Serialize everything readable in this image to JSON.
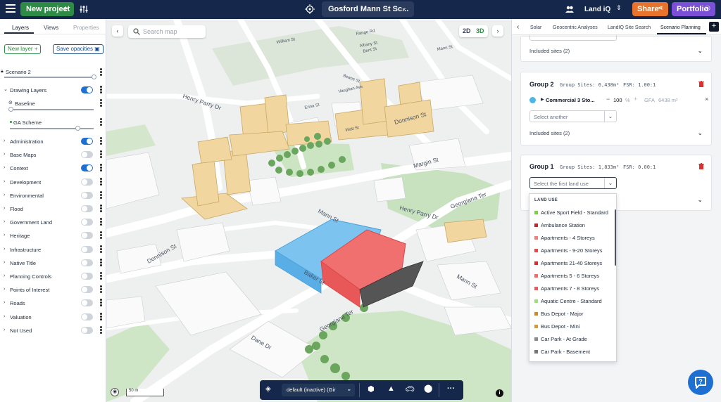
{
  "topbar": {
    "new_project": "New project",
    "project_name": "Gosford Mann St Sc...",
    "product": "Land iQ",
    "share": "Share",
    "portfolio": "Portfolio"
  },
  "left": {
    "tabs": [
      "Layers",
      "Views",
      "Properties"
    ],
    "new_layer": "New layer",
    "save_opacities": "Save opacities",
    "scenario": "Scenario 2",
    "drawing_layers": "Drawing Layers",
    "baseline": "Baseline",
    "ga_scheme": "GA Scheme",
    "layers": [
      {
        "label": "Administration",
        "on": true
      },
      {
        "label": "Base Maps",
        "on": false
      },
      {
        "label": "Context",
        "on": true
      },
      {
        "label": "Development",
        "on": false
      },
      {
        "label": "Environmental",
        "on": false
      },
      {
        "label": "Flood",
        "on": false
      },
      {
        "label": "Government Land",
        "on": false
      },
      {
        "label": "Heritage",
        "on": false
      },
      {
        "label": "Infrastructure",
        "on": false
      },
      {
        "label": "Native Title",
        "on": false
      },
      {
        "label": "Planning Controls",
        "on": false
      },
      {
        "label": "Points of Interest",
        "on": false
      },
      {
        "label": "Roads",
        "on": false
      },
      {
        "label": "Valuation",
        "on": false
      },
      {
        "label": "Not Used",
        "on": false
      }
    ]
  },
  "map": {
    "search_placeholder": "Search map",
    "view_2d": "2D",
    "view_3d": "3D",
    "scale": "50 m",
    "streets": {
      "henry_parry_top": "Henry Parry Dr",
      "donnison_top": "Donnison St",
      "margin_st": "Margin St",
      "henry_parry_mid": "Henry Parry Dr",
      "georgiana_right": "Georgiana Ter",
      "mann_st": "Mann St",
      "mann_st_right": "Mann St",
      "donnison_left": "Donnison St",
      "baker_st": "Baker St",
      "georgiana_bottom": "Georgiana Ter",
      "dane_dr": "Dane Dr",
      "erina_st": "Erina St",
      "beane_st": "Beane St",
      "william_st": "William St",
      "mann_top": "Mann St",
      "albany_st": "Albany St",
      "watt_st": "Watt St",
      "vaughan_ave": "Vaughan Ave",
      "bent_st": "Bent St",
      "range_rd": "Range Rd"
    }
  },
  "bottombar": {
    "view_select": "default (inactive) (Gir"
  },
  "right": {
    "tabs": [
      "Solar",
      "Geocentric Analyses",
      "LandIQ Site Search",
      "Scenario Planning"
    ],
    "included_sites_top": "Included sites (2)",
    "group2": {
      "title": "Group 2",
      "sites": "Group Sites: 6,438m²",
      "fsr": "FSR: 1.00:1",
      "use": "Commercial 3 Sto...",
      "value": "100",
      "pct": "%",
      "gfa_label": "GFA",
      "gfa_value": "6438 m²",
      "select_another": "Select another",
      "included_sites": "Included sites (2)"
    },
    "group1": {
      "title": "Group 1",
      "sites": "Group Sites: 1,833m²",
      "fsr": "FSR: 0.00:1",
      "select_placeholder": "Select the first land use"
    },
    "dropdown": {
      "header": "LAND USE",
      "items": [
        {
          "label": "Active Sport Field - Standard",
          "color": "#7fcf3f"
        },
        {
          "label": "Ambulance Station",
          "color": "#c0262d"
        },
        {
          "label": "Apartments - 4 Storeys",
          "color": "#f08080"
        },
        {
          "label": "Apartments - 9-20 Storeys",
          "color": "#e84a4a"
        },
        {
          "label": "Apartments 21-40 Storeys",
          "color": "#d62f2f"
        },
        {
          "label": "Apartments 5 - 6 Storeys",
          "color": "#f26b6b"
        },
        {
          "label": "Apartments 7 - 8 Storeys",
          "color": "#ec5a5a"
        },
        {
          "label": "Aquatic Centre - Standard",
          "color": "#9be07a"
        },
        {
          "label": "Bus Depot - Major",
          "color": "#c98a2b"
        },
        {
          "label": "Bus Depot - Mini",
          "color": "#d49a3a"
        },
        {
          "label": "Car Park - At Grade",
          "color": "#8a8a8a"
        },
        {
          "label": "Car Park - Basement",
          "color": "#777777"
        }
      ]
    }
  }
}
